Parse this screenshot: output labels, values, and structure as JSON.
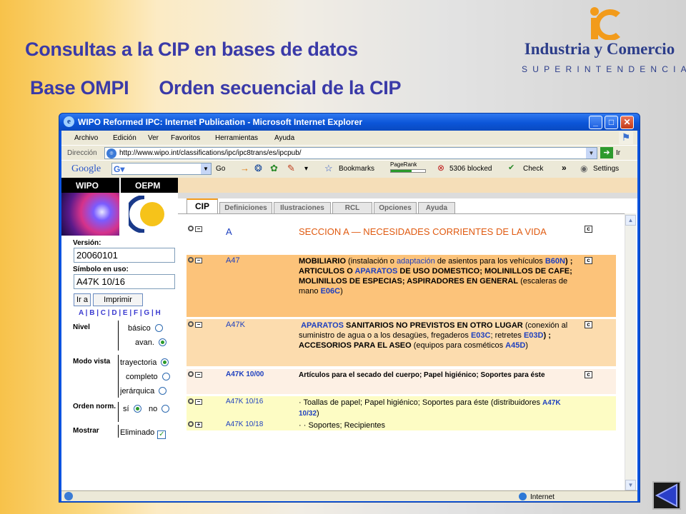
{
  "slide": {
    "title_line1": "Consultas a  la CIP en bases de datos",
    "title_base": "Base  OMPI",
    "title_orden": "Orden secuencial de la CIP"
  },
  "logo": {
    "name": "Industria y Comercio",
    "sub": "SUPERINTENDENCIA",
    "colors": {
      "orange": "#f29b1b",
      "blue": "#2c3d8a"
    }
  },
  "browser": {
    "title": "WIPO Reformed IPC: Internet Publication - Microsoft Internet Explorer",
    "menu": [
      "Archivo",
      "Edición",
      "Ver",
      "Favoritos",
      "Herramientas",
      "Ayuda"
    ],
    "address_label": "Dirección",
    "url": "http://www.wipo.int/classifications/ipc/ipc8trans/es/ipcpub/",
    "go_label": "Ir",
    "google": {
      "logo": "Google",
      "go": "Go",
      "bookmarks": "Bookmarks",
      "pagerank": "PageRank",
      "blocked": "5306 blocked",
      "check": "Check",
      "more": "»",
      "settings": "Settings"
    },
    "status": {
      "zone": "Internet"
    }
  },
  "left": {
    "wipo": "WIPO",
    "oepm": "OEPM",
    "version_label": "Versión:",
    "version_value": "20060101",
    "symbol_label": "Símbolo en uso:",
    "symbol_value": "A47K 10/16",
    "go_button": "Ir a",
    "print_button": "Imprimir",
    "letters": "A | B | C | D | E | F | G | H",
    "nivel": {
      "label": "Nivel",
      "basic": "básico",
      "adv": "avan."
    },
    "modo": {
      "label": "Modo vista",
      "traj": "trayectoria",
      "complete": "completo",
      "hier": "jerárquica"
    },
    "orden": {
      "label": "Orden norm.",
      "yes": "sí",
      "no": "no"
    },
    "mostrar": {
      "label": "Mostrar",
      "removed": "Eliminado"
    }
  },
  "tabs": [
    "CIP",
    "Definiciones",
    "Ilustraciones",
    "RCL",
    "Opciones",
    "Ayuda"
  ],
  "entries": {
    "e0": {
      "symbol": "A",
      "text": "SECCION A — NECESIDADES CORRIENTES DE LA VIDA"
    },
    "e1": {
      "symbol": "A47",
      "t1": "MOBILIARIO",
      "t2": " (instalación o ",
      "t3": "adaptación",
      "t4": " de asientos para los vehículos ",
      "t5": "B60N",
      "t6": ") ; ARTICULOS O ",
      "t7": "APARATOS",
      "t8": " DE USO DOMESTICO; MOLINILLOS DE CAFE; MOLINILLOS DE ESPECIAS; ASPIRADORES EN GENERAL",
      "t9": " (escaleras de mano ",
      "t10": "E06C",
      "t11": ")"
    },
    "e2": {
      "symbol": "A47K",
      "t1": "APARATOS",
      "t2": " SANITARIOS NO PREVISTOS EN OTRO LUGAR",
      "t3": " (conexión al suministro de agua o a los desagües, fregaderos ",
      "t4": "E03C",
      "t5": "; retretes ",
      "t6": "E03D",
      "t7": ") ; ",
      "t8": "ACCESORIOS PARA EL ASEO",
      "t9": " (equipos para cosméticos ",
      "t10": "A45D",
      "t11": ")"
    },
    "e3": {
      "symbol": "A47K 10/00",
      "text": "Artículos para el secado del cuerpo; Papel higiénico; Soportes para éste"
    },
    "e4": {
      "symbol": "A47K 10/16",
      "t1": "· Toallas de papel; Papel higiénico; Soportes para éste (distribuidores ",
      "t2": "A47K 10/32",
      "t3": ")"
    },
    "e5": {
      "symbol": "A47K 10/18",
      "text": "· · Soportes; Recipientes"
    }
  }
}
